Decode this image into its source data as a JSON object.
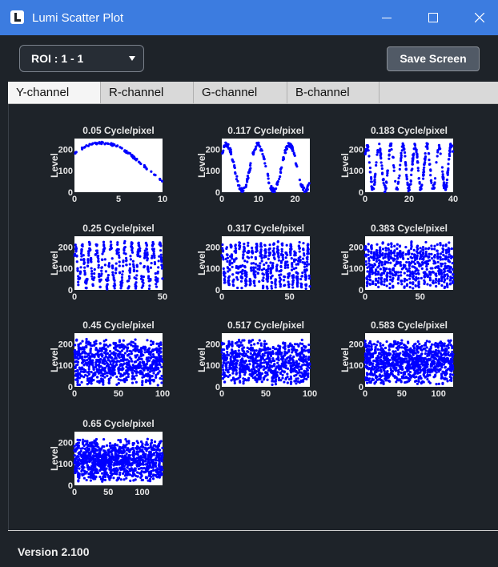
{
  "window": {
    "title": "Lumi Scatter Plot"
  },
  "toolbar": {
    "roi_label": "ROI : 1 - 1",
    "save_label": "Save Screen"
  },
  "tabs": [
    {
      "label": "Y-channel",
      "active": true
    },
    {
      "label": "R-channel",
      "active": false
    },
    {
      "label": "G-channel",
      "active": false
    },
    {
      "label": "B-channel",
      "active": false
    }
  ],
  "footer": {
    "version": "Version 2.100"
  },
  "colors": {
    "point": "#0000ff",
    "panel_bg": "#1e2329",
    "axis_text": "#e6e6e6"
  },
  "chart_data": [
    {
      "type": "scatter",
      "title": "0.05 Cycle/pixel",
      "ylabel": "Level",
      "freq": 0.05,
      "xlim": [
        0,
        10
      ],
      "xticks": [
        0,
        5,
        10
      ],
      "ylim": [
        0,
        250
      ],
      "yticks": [
        0,
        100,
        200
      ]
    },
    {
      "type": "scatter",
      "title": "0.117 Cycle/pixel",
      "ylabel": "Level",
      "freq": 0.117,
      "xlim": [
        0,
        24
      ],
      "xticks": [
        0,
        10,
        20
      ],
      "ylim": [
        0,
        250
      ],
      "yticks": [
        0,
        100,
        200
      ]
    },
    {
      "type": "scatter",
      "title": "0.183 Cycle/pixel",
      "ylabel": "Level",
      "freq": 0.183,
      "xlim": [
        0,
        40
      ],
      "xticks": [
        0,
        20,
        40
      ],
      "ylim": [
        0,
        250
      ],
      "yticks": [
        0,
        100,
        200
      ]
    },
    {
      "type": "scatter",
      "title": "0.25 Cycle/pixel",
      "ylabel": "Level",
      "freq": 0.25,
      "xlim": [
        0,
        50
      ],
      "xticks": [
        0,
        50
      ],
      "ylim": [
        0,
        250
      ],
      "yticks": [
        0,
        100,
        200
      ]
    },
    {
      "type": "scatter",
      "title": "0.317 Cycle/pixel",
      "ylabel": "Level",
      "freq": 0.317,
      "xlim": [
        0,
        65
      ],
      "xticks": [
        0,
        50
      ],
      "ylim": [
        0,
        250
      ],
      "yticks": [
        0,
        100,
        200
      ]
    },
    {
      "type": "scatter",
      "title": "0.383 Cycle/pixel",
      "ylabel": "Level",
      "freq": 0.383,
      "xlim": [
        0,
        80
      ],
      "xticks": [
        0,
        50
      ],
      "ylim": [
        0,
        250
      ],
      "yticks": [
        0,
        100,
        200
      ]
    },
    {
      "type": "scatter",
      "title": "0.45 Cycle/pixel",
      "ylabel": "Level",
      "freq": 0.45,
      "xlim": [
        0,
        100
      ],
      "xticks": [
        0,
        50,
        100
      ],
      "ylim": [
        0,
        250
      ],
      "yticks": [
        0,
        100,
        200
      ]
    },
    {
      "type": "scatter",
      "title": "0.517 Cycle/pixel",
      "ylabel": "Level",
      "freq": 0.517,
      "xlim": [
        0,
        100
      ],
      "xticks": [
        0,
        50,
        100
      ],
      "ylim": [
        0,
        250
      ],
      "yticks": [
        0,
        100,
        200
      ]
    },
    {
      "type": "scatter",
      "title": "0.583 Cycle/pixel",
      "ylabel": "Level",
      "freq": 0.583,
      "xlim": [
        0,
        120
      ],
      "xticks": [
        0,
        50,
        100
      ],
      "ylim": [
        0,
        250
      ],
      "yticks": [
        0,
        100,
        200
      ]
    },
    {
      "type": "scatter",
      "title": "0.65 Cycle/pixel",
      "ylabel": "Level",
      "freq": 0.65,
      "xlim": [
        0,
        130
      ],
      "xticks": [
        0,
        50,
        100
      ],
      "ylim": [
        0,
        250
      ],
      "yticks": [
        0,
        100,
        200
      ]
    }
  ]
}
